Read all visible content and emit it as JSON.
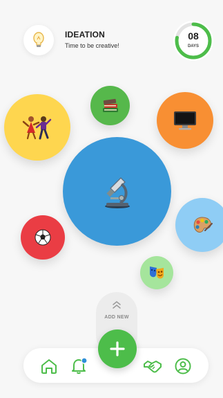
{
  "header": {
    "icon": "lightbulb-icon",
    "title": "IDEATION",
    "subtitle": "Time to be creative!"
  },
  "days_badge": {
    "number": "08",
    "label": "DAYS",
    "progress_fraction": 0.78,
    "ring_color": "#4dbd4a",
    "track_color": "#e3e3e3"
  },
  "bubbles": [
    {
      "name": "dance",
      "icon": "dancers-icon",
      "color": "#fed64f"
    },
    {
      "name": "books",
      "icon": "books-icon",
      "color": "#56b84b"
    },
    {
      "name": "computer",
      "icon": "computer-icon",
      "color": "#f88f33"
    },
    {
      "name": "science",
      "icon": "microscope-icon",
      "color": "#3a99d9"
    },
    {
      "name": "art",
      "icon": "palette-icon",
      "color": "#8fcdf5"
    },
    {
      "name": "sport",
      "icon": "soccer-ball-icon",
      "color": "#ea3d44"
    },
    {
      "name": "theater",
      "icon": "theater-masks-icon",
      "color": "#a5e59c"
    }
  ],
  "add_new": {
    "label": "ADD NEW",
    "icon": "plus-icon",
    "color": "#4dbd4a"
  },
  "bottom_nav": {
    "items": [
      {
        "name": "home",
        "icon": "home-icon"
      },
      {
        "name": "notifications",
        "icon": "bell-icon",
        "badge_color": "#2f8fd8"
      },
      {
        "name": "partners",
        "icon": "handshake-icon"
      },
      {
        "name": "profile",
        "icon": "user-icon"
      }
    ],
    "icon_color": "#4dbd4a"
  }
}
